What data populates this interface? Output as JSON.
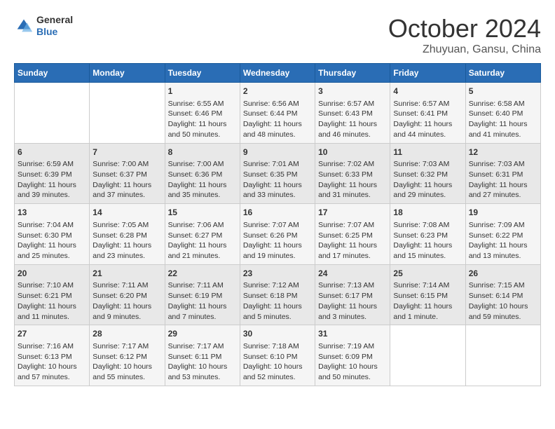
{
  "logo": {
    "general": "General",
    "blue": "Blue"
  },
  "title": "October 2024",
  "subtitle": "Zhuyuan, Gansu, China",
  "days_of_week": [
    "Sunday",
    "Monday",
    "Tuesday",
    "Wednesday",
    "Thursday",
    "Friday",
    "Saturday"
  ],
  "weeks": [
    [
      {
        "day": "",
        "sunrise": "",
        "sunset": "",
        "daylight": ""
      },
      {
        "day": "",
        "sunrise": "",
        "sunset": "",
        "daylight": ""
      },
      {
        "day": "1",
        "sunrise": "Sunrise: 6:55 AM",
        "sunset": "Sunset: 6:46 PM",
        "daylight": "Daylight: 11 hours and 50 minutes."
      },
      {
        "day": "2",
        "sunrise": "Sunrise: 6:56 AM",
        "sunset": "Sunset: 6:44 PM",
        "daylight": "Daylight: 11 hours and 48 minutes."
      },
      {
        "day": "3",
        "sunrise": "Sunrise: 6:57 AM",
        "sunset": "Sunset: 6:43 PM",
        "daylight": "Daylight: 11 hours and 46 minutes."
      },
      {
        "day": "4",
        "sunrise": "Sunrise: 6:57 AM",
        "sunset": "Sunset: 6:41 PM",
        "daylight": "Daylight: 11 hours and 44 minutes."
      },
      {
        "day": "5",
        "sunrise": "Sunrise: 6:58 AM",
        "sunset": "Sunset: 6:40 PM",
        "daylight": "Daylight: 11 hours and 41 minutes."
      }
    ],
    [
      {
        "day": "6",
        "sunrise": "Sunrise: 6:59 AM",
        "sunset": "Sunset: 6:39 PM",
        "daylight": "Daylight: 11 hours and 39 minutes."
      },
      {
        "day": "7",
        "sunrise": "Sunrise: 7:00 AM",
        "sunset": "Sunset: 6:37 PM",
        "daylight": "Daylight: 11 hours and 37 minutes."
      },
      {
        "day": "8",
        "sunrise": "Sunrise: 7:00 AM",
        "sunset": "Sunset: 6:36 PM",
        "daylight": "Daylight: 11 hours and 35 minutes."
      },
      {
        "day": "9",
        "sunrise": "Sunrise: 7:01 AM",
        "sunset": "Sunset: 6:35 PM",
        "daylight": "Daylight: 11 hours and 33 minutes."
      },
      {
        "day": "10",
        "sunrise": "Sunrise: 7:02 AM",
        "sunset": "Sunset: 6:33 PM",
        "daylight": "Daylight: 11 hours and 31 minutes."
      },
      {
        "day": "11",
        "sunrise": "Sunrise: 7:03 AM",
        "sunset": "Sunset: 6:32 PM",
        "daylight": "Daylight: 11 hours and 29 minutes."
      },
      {
        "day": "12",
        "sunrise": "Sunrise: 7:03 AM",
        "sunset": "Sunset: 6:31 PM",
        "daylight": "Daylight: 11 hours and 27 minutes."
      }
    ],
    [
      {
        "day": "13",
        "sunrise": "Sunrise: 7:04 AM",
        "sunset": "Sunset: 6:30 PM",
        "daylight": "Daylight: 11 hours and 25 minutes."
      },
      {
        "day": "14",
        "sunrise": "Sunrise: 7:05 AM",
        "sunset": "Sunset: 6:28 PM",
        "daylight": "Daylight: 11 hours and 23 minutes."
      },
      {
        "day": "15",
        "sunrise": "Sunrise: 7:06 AM",
        "sunset": "Sunset: 6:27 PM",
        "daylight": "Daylight: 11 hours and 21 minutes."
      },
      {
        "day": "16",
        "sunrise": "Sunrise: 7:07 AM",
        "sunset": "Sunset: 6:26 PM",
        "daylight": "Daylight: 11 hours and 19 minutes."
      },
      {
        "day": "17",
        "sunrise": "Sunrise: 7:07 AM",
        "sunset": "Sunset: 6:25 PM",
        "daylight": "Daylight: 11 hours and 17 minutes."
      },
      {
        "day": "18",
        "sunrise": "Sunrise: 7:08 AM",
        "sunset": "Sunset: 6:23 PM",
        "daylight": "Daylight: 11 hours and 15 minutes."
      },
      {
        "day": "19",
        "sunrise": "Sunrise: 7:09 AM",
        "sunset": "Sunset: 6:22 PM",
        "daylight": "Daylight: 11 hours and 13 minutes."
      }
    ],
    [
      {
        "day": "20",
        "sunrise": "Sunrise: 7:10 AM",
        "sunset": "Sunset: 6:21 PM",
        "daylight": "Daylight: 11 hours and 11 minutes."
      },
      {
        "day": "21",
        "sunrise": "Sunrise: 7:11 AM",
        "sunset": "Sunset: 6:20 PM",
        "daylight": "Daylight: 11 hours and 9 minutes."
      },
      {
        "day": "22",
        "sunrise": "Sunrise: 7:11 AM",
        "sunset": "Sunset: 6:19 PM",
        "daylight": "Daylight: 11 hours and 7 minutes."
      },
      {
        "day": "23",
        "sunrise": "Sunrise: 7:12 AM",
        "sunset": "Sunset: 6:18 PM",
        "daylight": "Daylight: 11 hours and 5 minutes."
      },
      {
        "day": "24",
        "sunrise": "Sunrise: 7:13 AM",
        "sunset": "Sunset: 6:17 PM",
        "daylight": "Daylight: 11 hours and 3 minutes."
      },
      {
        "day": "25",
        "sunrise": "Sunrise: 7:14 AM",
        "sunset": "Sunset: 6:15 PM",
        "daylight": "Daylight: 11 hours and 1 minute."
      },
      {
        "day": "26",
        "sunrise": "Sunrise: 7:15 AM",
        "sunset": "Sunset: 6:14 PM",
        "daylight": "Daylight: 10 hours and 59 minutes."
      }
    ],
    [
      {
        "day": "27",
        "sunrise": "Sunrise: 7:16 AM",
        "sunset": "Sunset: 6:13 PM",
        "daylight": "Daylight: 10 hours and 57 minutes."
      },
      {
        "day": "28",
        "sunrise": "Sunrise: 7:17 AM",
        "sunset": "Sunset: 6:12 PM",
        "daylight": "Daylight: 10 hours and 55 minutes."
      },
      {
        "day": "29",
        "sunrise": "Sunrise: 7:17 AM",
        "sunset": "Sunset: 6:11 PM",
        "daylight": "Daylight: 10 hours and 53 minutes."
      },
      {
        "day": "30",
        "sunrise": "Sunrise: 7:18 AM",
        "sunset": "Sunset: 6:10 PM",
        "daylight": "Daylight: 10 hours and 52 minutes."
      },
      {
        "day": "31",
        "sunrise": "Sunrise: 7:19 AM",
        "sunset": "Sunset: 6:09 PM",
        "daylight": "Daylight: 10 hours and 50 minutes."
      },
      {
        "day": "",
        "sunrise": "",
        "sunset": "",
        "daylight": ""
      },
      {
        "day": "",
        "sunrise": "",
        "sunset": "",
        "daylight": ""
      }
    ]
  ]
}
